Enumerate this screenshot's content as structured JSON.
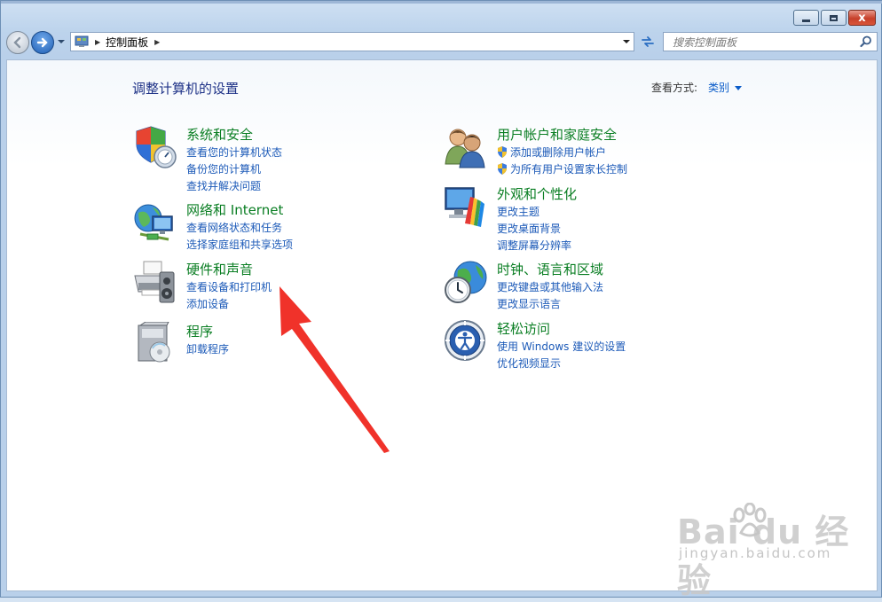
{
  "titlebar": {
    "minimize_label": "–",
    "maximize_label": "□",
    "close_label": "x"
  },
  "nav": {
    "address_path": "控制面板",
    "search_placeholder": "搜索控制面板"
  },
  "main": {
    "title": "调整计算机的设置",
    "view_by_label": "查看方式:",
    "view_by_value": "类别"
  },
  "categories_left": [
    {
      "title": "系统和安全",
      "icon": "system-security-icon",
      "links": [
        "查看您的计算机状态",
        "备份您的计算机",
        "查找并解决问题"
      ]
    },
    {
      "title": "网络和 Internet",
      "icon": "network-internet-icon",
      "links": [
        "查看网络状态和任务",
        "选择家庭组和共享选项"
      ]
    },
    {
      "title": "硬件和声音",
      "icon": "hardware-sound-icon",
      "links": [
        "查看设备和打印机",
        "添加设备"
      ]
    },
    {
      "title": "程序",
      "icon": "programs-icon",
      "links": [
        "卸载程序"
      ]
    }
  ],
  "categories_right": [
    {
      "title": "用户帐户和家庭安全",
      "icon": "user-accounts-icon",
      "links": [
        "添加或删除用户帐户",
        "为所有用户设置家长控制"
      ]
    },
    {
      "title": "外观和个性化",
      "icon": "appearance-icon",
      "links": [
        "更改主题",
        "更改桌面背景",
        "调整屏幕分辨率"
      ]
    },
    {
      "title": "时钟、语言和区域",
      "icon": "clock-language-icon",
      "links": [
        "更改键盘或其他输入法",
        "更改显示语言"
      ]
    },
    {
      "title": "轻松访问",
      "icon": "ease-of-access-icon",
      "links": [
        "使用 Windows 建议的设置",
        "优化视频显示"
      ]
    }
  ],
  "watermark": {
    "brand": "Bai  du 经验",
    "url": "jingyan.baidu.com"
  },
  "colors": {
    "link": "#1c5ab8",
    "category_title": "#0a7e23",
    "page_title": "#1e3287",
    "annotation_arrow": "#f0322a"
  }
}
